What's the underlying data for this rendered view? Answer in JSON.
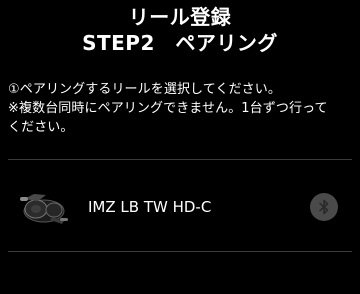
{
  "header": {
    "title": "リール登録",
    "subtitle": "STEP2　ペアリング"
  },
  "instructions": {
    "line1": "①ペアリングするリールを選択してください。",
    "line2": "※複数台同時にペアリングできません。1台ずつ行って",
    "line3": "ください。"
  },
  "device_list": {
    "items": [
      {
        "name": "IMZ LB TW HD-C",
        "image_icon": "reel-image",
        "status_icon": "bluetooth-icon"
      }
    ]
  },
  "colors": {
    "background": "#000000",
    "text": "#ffffff",
    "divider": "#3a3a3a",
    "bluetooth_button": "#4a4a4a",
    "bluetooth_glyph": "#2a2a2a"
  }
}
